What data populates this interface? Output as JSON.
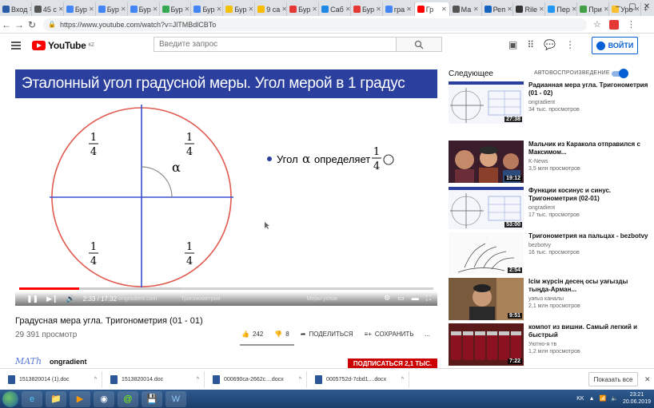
{
  "browser": {
    "tabs": [
      {
        "label": "Вход",
        "color": "#2a5ca8"
      },
      {
        "label": "45 с",
        "color": "#555555"
      },
      {
        "label": "Бур",
        "color": "#4285f4"
      },
      {
        "label": "Бур",
        "color": "#4285f4"
      },
      {
        "label": "Бур",
        "color": "#4285f4"
      },
      {
        "label": "Бур",
        "color": "#34a853"
      },
      {
        "label": "Бур",
        "color": "#4285f4"
      },
      {
        "label": "Бур",
        "color": "#f4c20d"
      },
      {
        "label": "9 са",
        "color": "#fbbc05"
      },
      {
        "label": "Бур",
        "color": "#e53935"
      },
      {
        "label": "Саб",
        "color": "#1e88e5"
      },
      {
        "label": "Бур",
        "color": "#e53935"
      },
      {
        "label": "гра",
        "color": "#4285f4"
      },
      {
        "label": "Гр",
        "color": "#ff0000",
        "active": true
      },
      {
        "label": "Ма",
        "color": "#555555"
      },
      {
        "label": "Реп",
        "color": "#1565c0"
      },
      {
        "label": "Rile",
        "color": "#333333"
      },
      {
        "label": "Пер",
        "color": "#2196f3"
      },
      {
        "label": "При",
        "color": "#43a047"
      },
      {
        "label": "Уро",
        "color": "#fbc02d"
      }
    ],
    "url": "https://www.youtube.com/watch?v=JlTMBdlCBTo"
  },
  "header": {
    "logo_text": "YouTube",
    "logo_sup": "KZ",
    "search_placeholder": "Введите запрос",
    "signin_label": "ВОЙТИ"
  },
  "slide": {
    "title": "Эталонный угол градусной меры. Угол мерой в 1 градус",
    "fraction_num": "1",
    "fraction_den": "4",
    "bullet_text": "Угол",
    "alpha": "α",
    "verb": "определяет",
    "circle_color": "#e05a4f",
    "axis_color": "#3a4fcf"
  },
  "player": {
    "time": "2:33 / 17:32",
    "progress": 0.145,
    "buffered": 0.39,
    "overlay_left": "ongradient.com",
    "overlay_mid": "Тригонометрия",
    "overlay_right": "Меры углов"
  },
  "video": {
    "title": "Градусная мера угла. Тригонометрия (01 - 01)",
    "views": "29 391 просмотр",
    "likes": "242",
    "dislikes": "8",
    "share_label": "ПОДЕЛИТЬСЯ",
    "save_label": "СОХРАНИТЬ",
    "more_label": "...",
    "channel_logo": "MATh",
    "channel": "ongradient",
    "subscribe_label": "ПОДПИСАТЬСЯ 2,1 ТЫС."
  },
  "sidebar": {
    "heading": "Следующее",
    "autoplay_label": "АВТОВОСПРОИЗВЕДЕНИЕ",
    "items": [
      {
        "title": "Радианная мера угла. Тригонометрия (01 - 02)",
        "channel": "ongradient",
        "views": "34 тыс. просмотров",
        "duration": "27:38",
        "thumb": "math"
      },
      {
        "title": "Мальчик из Каракола отправился с Максимом...",
        "channel": "K-News",
        "views": "3,5 млн просмотров",
        "duration": "19:12",
        "thumb": "people"
      },
      {
        "title": "Функции косинус и синус. Тригонометрия (02-01)",
        "channel": "ongradient",
        "views": "17 тыс. просмотров",
        "duration": "53:00",
        "thumb": "math"
      },
      {
        "title": "Тригонометрия на пальцах - bezbotvy",
        "channel": "bezbotvy",
        "views": "16 тыс. просмотров",
        "duration": "2:54",
        "thumb": "hand"
      },
      {
        "title": "Ісім жүрсін десең осы уағызды тыңда-Арман...",
        "channel": "уағыз каналы",
        "views": "2,1 млн просмотров",
        "duration": "9:51",
        "thumb": "man"
      },
      {
        "title": "компот из вишни. Самый легкий и быстрый",
        "channel": "Уютно-я тв",
        "views": "1,2 млн просмотров",
        "duration": "7:22",
        "thumb": "jars"
      }
    ]
  },
  "downloads": {
    "items": [
      "1513820014 (1).doc",
      "1513820014.doc",
      "000690ca-2662c....docx",
      "0005752d-7cbd1....docx"
    ],
    "show_all": "Показать все"
  },
  "taskbar": {
    "lang": "KK",
    "time": "23:21",
    "date": "20.06.2019"
  }
}
